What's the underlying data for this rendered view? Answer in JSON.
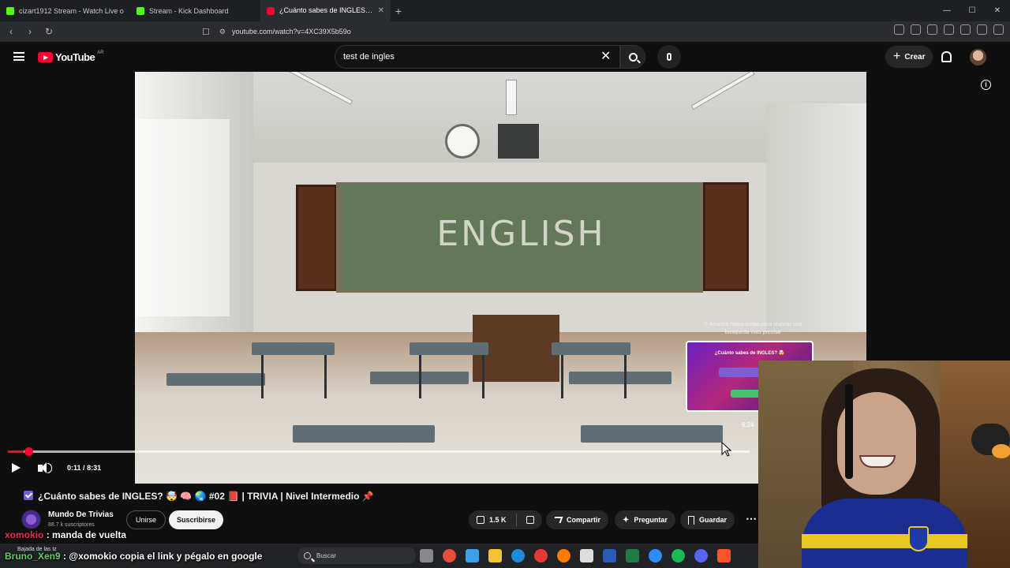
{
  "browser": {
    "tabs": [
      {
        "label": "cizart1912 Stream - Watch Live o",
        "kind": "kick",
        "active": false
      },
      {
        "label": "Stream - Kick Dashboard",
        "kind": "kick",
        "active": false
      },
      {
        "label": "¿Cuánto sabes de INGLES? 🤯",
        "kind": "youtube",
        "active": true
      }
    ],
    "new_tab": "+",
    "url": "youtube.com/watch?v=4XC39X5b59o"
  },
  "youtube": {
    "logo_text": "YouTube",
    "country_code": "AR",
    "search_value": "test de ingles",
    "create_label": "Crear"
  },
  "player": {
    "current_time": "0:11",
    "duration": "8:31",
    "progress_fraction": 0.0215,
    "hover_time": "6:24",
    "board_text": "ENGLISH",
    "drag_hint": "⇧ Arrastra hacia arriba para realizar una búsqueda más precisa",
    "preview_title": "¿Cuánto sabes de INGLES? 🤯"
  },
  "video_info": {
    "title": "¿Cuánto sabes de INGLES? 🤯 🧠 🌏 #02 📕 | TRIVIA | Nivel Intermedio 📌",
    "channel_name": "Mundo De Trivias",
    "channel_subs": "88.7 k suscriptores",
    "join_label": "Unirse",
    "subscribe_label": "Suscribirse",
    "like_count": "1.5 K",
    "share_label": "Compartir",
    "ask_label": "Preguntar",
    "save_label": "Guardar",
    "more_label": "⋯"
  },
  "chat": {
    "line1_user": "xomokio",
    "line1_text": ": manda de vuelta",
    "line2_user": "Bruno_Xen9",
    "line2_text": ": @xomokio copia el link y pégalo en google",
    "small_note": "Bajada de las tz"
  },
  "taskbar": {
    "search_placeholder": "Buscar"
  },
  "colors": {
    "youtube_red": "#ff0033",
    "kick_green": "#53fc18",
    "background": "#0f0f0f"
  }
}
